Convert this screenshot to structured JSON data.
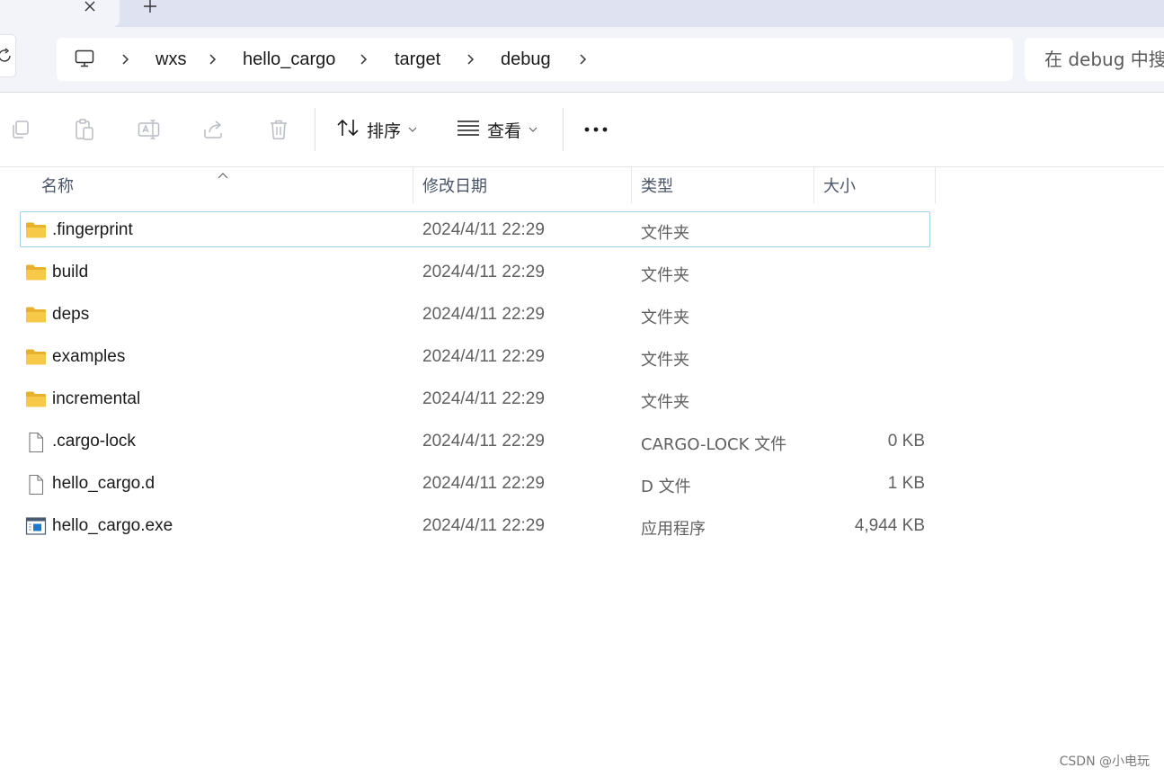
{
  "tabs": {
    "close_icon": "close-icon",
    "new_tab_icon": "plus-icon"
  },
  "breadcrumb": {
    "root_icon": "pc-icon",
    "items": [
      {
        "label": "wxs"
      },
      {
        "label": "hello_cargo"
      },
      {
        "label": "target"
      },
      {
        "label": "debug"
      }
    ]
  },
  "search": {
    "placeholder": "在 debug 中搜索"
  },
  "toolbar": {
    "icons": [
      "copy-icon",
      "paste-icon",
      "rename-icon",
      "share-icon",
      "delete-icon"
    ],
    "sort_label": "排序",
    "view_label": "查看",
    "more_icon": "more-icon"
  },
  "columns": {
    "name": "名称",
    "modified": "修改日期",
    "type": "类型",
    "size": "大小"
  },
  "files": [
    {
      "name": ".fingerprint",
      "modified": "2024/4/11 22:29",
      "type": "文件夹",
      "size": "",
      "icon": "folder-icon",
      "selected": true
    },
    {
      "name": "build",
      "modified": "2024/4/11 22:29",
      "type": "文件夹",
      "size": "",
      "icon": "folder-icon"
    },
    {
      "name": "deps",
      "modified": "2024/4/11 22:29",
      "type": "文件夹",
      "size": "",
      "icon": "folder-icon"
    },
    {
      "name": "examples",
      "modified": "2024/4/11 22:29",
      "type": "文件夹",
      "size": "",
      "icon": "folder-icon"
    },
    {
      "name": "incremental",
      "modified": "2024/4/11 22:29",
      "type": "文件夹",
      "size": "",
      "icon": "folder-icon"
    },
    {
      "name": ".cargo-lock",
      "modified": "2024/4/11 22:29",
      "type": "CARGO-LOCK 文件",
      "size": "0 KB",
      "icon": "file-icon"
    },
    {
      "name": "hello_cargo.d",
      "modified": "2024/4/11 22:29",
      "type": "D 文件",
      "size": "1 KB",
      "icon": "file-icon"
    },
    {
      "name": "hello_cargo.exe",
      "modified": "2024/4/11 22:29",
      "type": "应用程序",
      "size": "4,944 KB",
      "icon": "exe-icon"
    }
  ],
  "watermark": "CSDN @小电玩",
  "colors": {
    "tab_strip": "#dfe3f1",
    "chrome": "#f3f4f9",
    "selection_border": "#9fcfe6",
    "folder": "#f7c948"
  }
}
